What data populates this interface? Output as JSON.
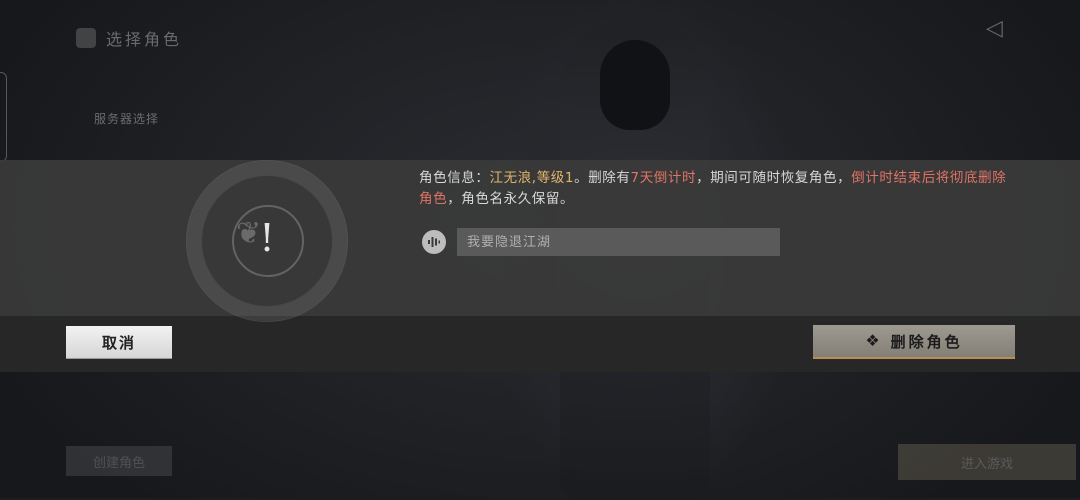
{
  "background": {
    "title": "选择角色",
    "subtitle": "服务器选择",
    "left_button": "创建角色",
    "right_button": "进入游戏"
  },
  "dialog": {
    "info_prefix": "角色信息：",
    "character_info": "江无浪,等级1",
    "text_1": "。删除有",
    "countdown": "7天倒计时",
    "text_2": "，期间可随时恢复角色，",
    "warning": "倒计时结束后将彻底删除角色",
    "text_3": "，角色名永久保留。",
    "input": {
      "value": "",
      "placeholder": "我要隐退江湖"
    },
    "cancel_label": "取消",
    "delete_label": "删除角色"
  },
  "colors": {
    "highlight_gold": "#e2b56b",
    "warning_red": "#e07466"
  },
  "icons": {
    "warning": "exclamation-icon",
    "voice": "microphone-icon",
    "delete": "diamond-icon"
  }
}
